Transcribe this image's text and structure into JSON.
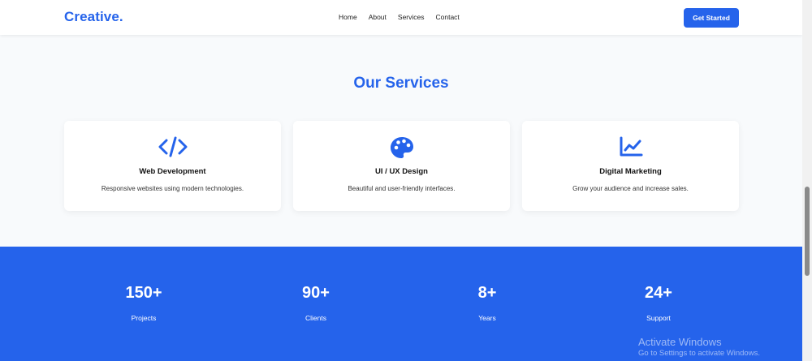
{
  "header": {
    "logo": "Creative.",
    "nav": [
      "Home",
      "About",
      "Services",
      "Contact"
    ],
    "cta": "Get Started"
  },
  "services": {
    "title": "Our Services",
    "cards": [
      {
        "icon": "code-icon",
        "title": "Web Development",
        "desc": "Responsive websites using modern technologies."
      },
      {
        "icon": "palette-icon",
        "title": "UI / UX Design",
        "desc": "Beautiful and user-friendly interfaces."
      },
      {
        "icon": "chart-line-icon",
        "title": "Digital Marketing",
        "desc": "Grow your audience and increase sales."
      }
    ]
  },
  "stats": [
    {
      "value": "150+",
      "label": "Projects"
    },
    {
      "value": "90+",
      "label": "Clients"
    },
    {
      "value": "8+",
      "label": "Years"
    },
    {
      "value": "24+",
      "label": "Support"
    }
  ],
  "watermark": {
    "line1": "Activate Windows",
    "line2": "Go to Settings to activate Windows."
  },
  "colors": {
    "accent": "#2563eb",
    "services_bg": "#f8fafc"
  }
}
